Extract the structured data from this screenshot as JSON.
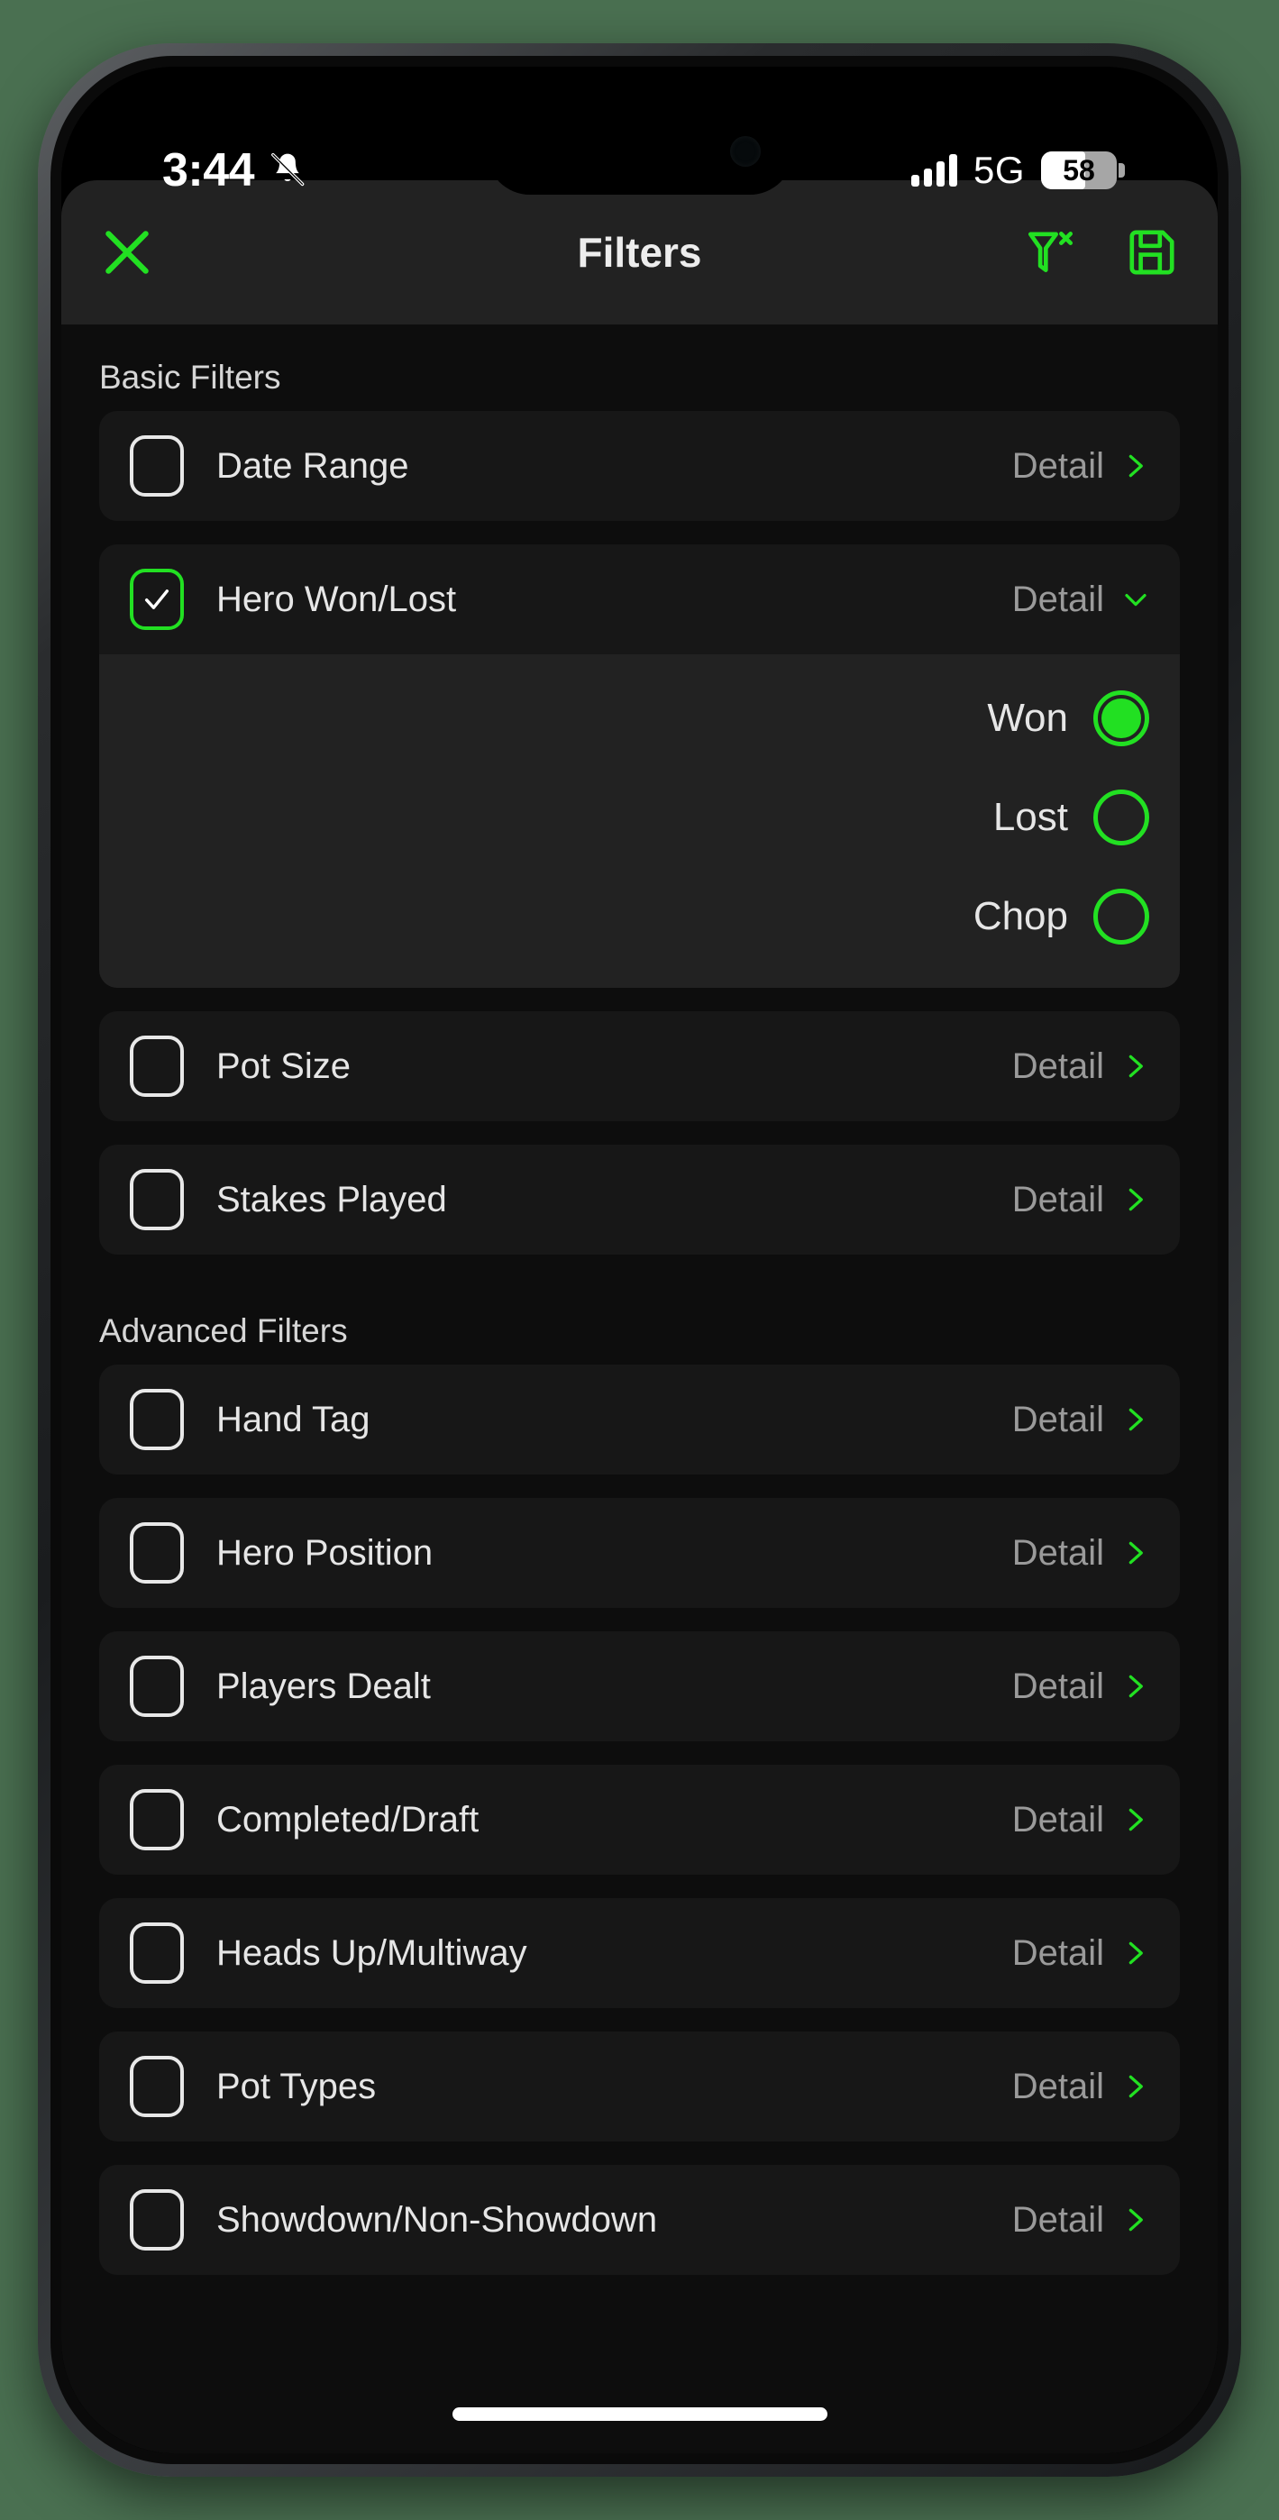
{
  "status_bar": {
    "time": "3:44",
    "silent_icon": "bell-slash-icon",
    "signal_icon": "cellular-signal-icon",
    "network": "5G",
    "battery_percent": "58",
    "battery_level": 58
  },
  "navbar": {
    "close_icon": "close-x-icon",
    "title": "Filters",
    "clear_filters_icon": "filter-remove-icon",
    "save_icon": "save-floppy-icon"
  },
  "sections": [
    {
      "header": "Basic Filters",
      "rows": [
        {
          "label": "Date Range",
          "checked": false,
          "detail_label": "Detail",
          "chevron": "chevron-right-icon",
          "expanded": false
        },
        {
          "label": "Hero Won/Lost",
          "checked": true,
          "detail_label": "Detail",
          "chevron": "chevron-down-icon",
          "expanded": true,
          "options": [
            {
              "label": "Won",
              "selected": true
            },
            {
              "label": "Lost",
              "selected": false
            },
            {
              "label": "Chop",
              "selected": false
            }
          ]
        },
        {
          "label": "Pot Size",
          "checked": false,
          "detail_label": "Detail",
          "chevron": "chevron-right-icon",
          "expanded": false
        },
        {
          "label": "Stakes Played",
          "checked": false,
          "detail_label": "Detail",
          "chevron": "chevron-right-icon",
          "expanded": false
        }
      ]
    },
    {
      "header": "Advanced Filters",
      "rows": [
        {
          "label": "Hand Tag",
          "checked": false,
          "detail_label": "Detail",
          "chevron": "chevron-right-icon",
          "expanded": false
        },
        {
          "label": "Hero Position",
          "checked": false,
          "detail_label": "Detail",
          "chevron": "chevron-right-icon",
          "expanded": false
        },
        {
          "label": "Players Dealt",
          "checked": false,
          "detail_label": "Detail",
          "chevron": "chevron-right-icon",
          "expanded": false
        },
        {
          "label": "Completed/Draft",
          "checked": false,
          "detail_label": "Detail",
          "chevron": "chevron-right-icon",
          "expanded": false
        },
        {
          "label": "Heads Up/Multiway",
          "checked": false,
          "detail_label": "Detail",
          "chevron": "chevron-right-icon",
          "expanded": false
        },
        {
          "label": "Pot Types",
          "checked": false,
          "detail_label": "Detail",
          "chevron": "chevron-right-icon",
          "expanded": false
        },
        {
          "label": "Showdown/Non-Showdown",
          "checked": false,
          "detail_label": "Detail",
          "chevron": "chevron-right-icon",
          "expanded": false
        }
      ]
    }
  ],
  "colors": {
    "accent_green": "#22e022",
    "page_background": "#0d0d0d",
    "row_background": "#171717",
    "navbar_background": "#222222",
    "outer_background": "#4a7051",
    "detail_text": "#9a9a9a"
  }
}
